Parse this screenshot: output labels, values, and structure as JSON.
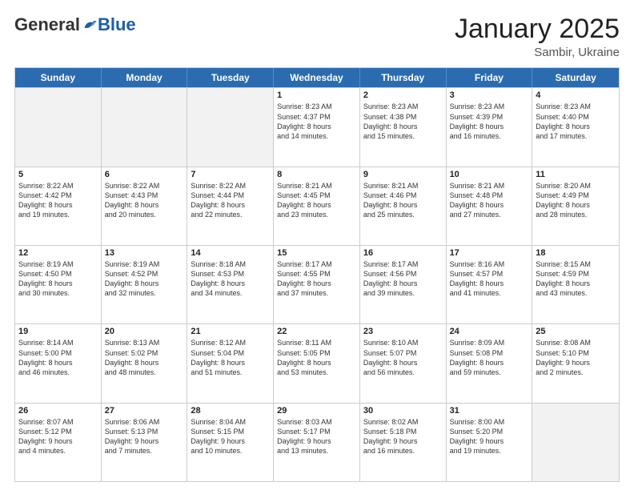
{
  "header": {
    "logo_general": "General",
    "logo_blue": "Blue",
    "month_title": "January 2025",
    "subtitle": "Sambir, Ukraine"
  },
  "weekdays": [
    "Sunday",
    "Monday",
    "Tuesday",
    "Wednesday",
    "Thursday",
    "Friday",
    "Saturday"
  ],
  "weeks": [
    [
      {
        "day": "",
        "empty": true
      },
      {
        "day": "",
        "empty": true
      },
      {
        "day": "",
        "empty": true
      },
      {
        "day": "1",
        "lines": [
          "Sunrise: 8:23 AM",
          "Sunset: 4:37 PM",
          "Daylight: 8 hours",
          "and 14 minutes."
        ]
      },
      {
        "day": "2",
        "lines": [
          "Sunrise: 8:23 AM",
          "Sunset: 4:38 PM",
          "Daylight: 8 hours",
          "and 15 minutes."
        ]
      },
      {
        "day": "3",
        "lines": [
          "Sunrise: 8:23 AM",
          "Sunset: 4:39 PM",
          "Daylight: 8 hours",
          "and 16 minutes."
        ]
      },
      {
        "day": "4",
        "lines": [
          "Sunrise: 8:23 AM",
          "Sunset: 4:40 PM",
          "Daylight: 8 hours",
          "and 17 minutes."
        ]
      }
    ],
    [
      {
        "day": "5",
        "lines": [
          "Sunrise: 8:22 AM",
          "Sunset: 4:42 PM",
          "Daylight: 8 hours",
          "and 19 minutes."
        ]
      },
      {
        "day": "6",
        "lines": [
          "Sunrise: 8:22 AM",
          "Sunset: 4:43 PM",
          "Daylight: 8 hours",
          "and 20 minutes."
        ]
      },
      {
        "day": "7",
        "lines": [
          "Sunrise: 8:22 AM",
          "Sunset: 4:44 PM",
          "Daylight: 8 hours",
          "and 22 minutes."
        ]
      },
      {
        "day": "8",
        "lines": [
          "Sunrise: 8:21 AM",
          "Sunset: 4:45 PM",
          "Daylight: 8 hours",
          "and 23 minutes."
        ]
      },
      {
        "day": "9",
        "lines": [
          "Sunrise: 8:21 AM",
          "Sunset: 4:46 PM",
          "Daylight: 8 hours",
          "and 25 minutes."
        ]
      },
      {
        "day": "10",
        "lines": [
          "Sunrise: 8:21 AM",
          "Sunset: 4:48 PM",
          "Daylight: 8 hours",
          "and 27 minutes."
        ]
      },
      {
        "day": "11",
        "lines": [
          "Sunrise: 8:20 AM",
          "Sunset: 4:49 PM",
          "Daylight: 8 hours",
          "and 28 minutes."
        ]
      }
    ],
    [
      {
        "day": "12",
        "lines": [
          "Sunrise: 8:19 AM",
          "Sunset: 4:50 PM",
          "Daylight: 8 hours",
          "and 30 minutes."
        ]
      },
      {
        "day": "13",
        "lines": [
          "Sunrise: 8:19 AM",
          "Sunset: 4:52 PM",
          "Daylight: 8 hours",
          "and 32 minutes."
        ]
      },
      {
        "day": "14",
        "lines": [
          "Sunrise: 8:18 AM",
          "Sunset: 4:53 PM",
          "Daylight: 8 hours",
          "and 34 minutes."
        ]
      },
      {
        "day": "15",
        "lines": [
          "Sunrise: 8:17 AM",
          "Sunset: 4:55 PM",
          "Daylight: 8 hours",
          "and 37 minutes."
        ]
      },
      {
        "day": "16",
        "lines": [
          "Sunrise: 8:17 AM",
          "Sunset: 4:56 PM",
          "Daylight: 8 hours",
          "and 39 minutes."
        ]
      },
      {
        "day": "17",
        "lines": [
          "Sunrise: 8:16 AM",
          "Sunset: 4:57 PM",
          "Daylight: 8 hours",
          "and 41 minutes."
        ]
      },
      {
        "day": "18",
        "lines": [
          "Sunrise: 8:15 AM",
          "Sunset: 4:59 PM",
          "Daylight: 8 hours",
          "and 43 minutes."
        ]
      }
    ],
    [
      {
        "day": "19",
        "lines": [
          "Sunrise: 8:14 AM",
          "Sunset: 5:00 PM",
          "Daylight: 8 hours",
          "and 46 minutes."
        ]
      },
      {
        "day": "20",
        "lines": [
          "Sunrise: 8:13 AM",
          "Sunset: 5:02 PM",
          "Daylight: 8 hours",
          "and 48 minutes."
        ]
      },
      {
        "day": "21",
        "lines": [
          "Sunrise: 8:12 AM",
          "Sunset: 5:04 PM",
          "Daylight: 8 hours",
          "and 51 minutes."
        ]
      },
      {
        "day": "22",
        "lines": [
          "Sunrise: 8:11 AM",
          "Sunset: 5:05 PM",
          "Daylight: 8 hours",
          "and 53 minutes."
        ]
      },
      {
        "day": "23",
        "lines": [
          "Sunrise: 8:10 AM",
          "Sunset: 5:07 PM",
          "Daylight: 8 hours",
          "and 56 minutes."
        ]
      },
      {
        "day": "24",
        "lines": [
          "Sunrise: 8:09 AM",
          "Sunset: 5:08 PM",
          "Daylight: 8 hours",
          "and 59 minutes."
        ]
      },
      {
        "day": "25",
        "lines": [
          "Sunrise: 8:08 AM",
          "Sunset: 5:10 PM",
          "Daylight: 9 hours",
          "and 2 minutes."
        ]
      }
    ],
    [
      {
        "day": "26",
        "lines": [
          "Sunrise: 8:07 AM",
          "Sunset: 5:12 PM",
          "Daylight: 9 hours",
          "and 4 minutes."
        ]
      },
      {
        "day": "27",
        "lines": [
          "Sunrise: 8:06 AM",
          "Sunset: 5:13 PM",
          "Daylight: 9 hours",
          "and 7 minutes."
        ]
      },
      {
        "day": "28",
        "lines": [
          "Sunrise: 8:04 AM",
          "Sunset: 5:15 PM",
          "Daylight: 9 hours",
          "and 10 minutes."
        ]
      },
      {
        "day": "29",
        "lines": [
          "Sunrise: 8:03 AM",
          "Sunset: 5:17 PM",
          "Daylight: 9 hours",
          "and 13 minutes."
        ]
      },
      {
        "day": "30",
        "lines": [
          "Sunrise: 8:02 AM",
          "Sunset: 5:18 PM",
          "Daylight: 9 hours",
          "and 16 minutes."
        ]
      },
      {
        "day": "31",
        "lines": [
          "Sunrise: 8:00 AM",
          "Sunset: 5:20 PM",
          "Daylight: 9 hours",
          "and 19 minutes."
        ]
      },
      {
        "day": "",
        "empty": true
      }
    ]
  ]
}
